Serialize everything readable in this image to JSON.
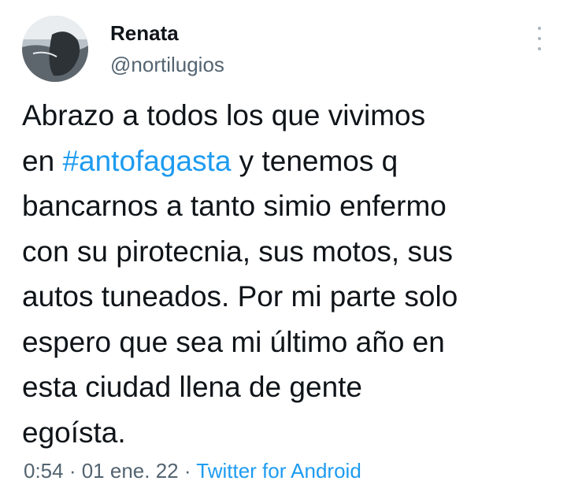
{
  "tweet": {
    "author": {
      "display_name": "Renata",
      "handle": "@nortilugios"
    },
    "menu_icon": "more-vertical-icon",
    "body": {
      "line1": "Abrazo a todos los que vivimos",
      "line2_prefix": "en ",
      "hashtag": "#antofagasta",
      "line2_suffix": " y tenemos q",
      "line3": "bancarnos a tanto simio enfermo",
      "line4": "con su pirotecnia, sus motos, sus",
      "line5": "autos tuneados. Por mi parte solo",
      "line6": "espero que sea mi último año en",
      "line7": "esta ciudad llena de gente",
      "line8": "egoísta."
    },
    "meta": {
      "time": "0:54",
      "separator": " · ",
      "date": "01 ene. 22",
      "source": "Twitter for Android"
    },
    "colors": {
      "link": "#1d9bf0",
      "text": "#0f1419",
      "secondary": "#536471"
    }
  }
}
